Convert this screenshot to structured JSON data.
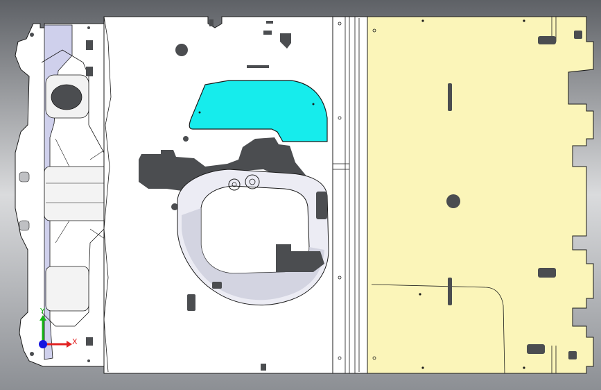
{
  "viewport": {
    "background_gradient": [
      "#5e6166",
      "#dadbdd",
      "#8c8f94"
    ]
  },
  "colors": {
    "part_fill": "#ffffff",
    "part_stroke": "#1a1a1a",
    "cutout_fill": "#4b4d50",
    "highlight_fill": "#16ecec",
    "yellow_fill": "#fbf5b9",
    "flange_fill": "#cfd0ec",
    "x_axis": "#e22222",
    "y_axis": "#15b515",
    "z_axis": "#1515e0"
  },
  "triad": {
    "x_label": "X",
    "y_label": "Y",
    "icon": "coordinate-triad-icon"
  }
}
